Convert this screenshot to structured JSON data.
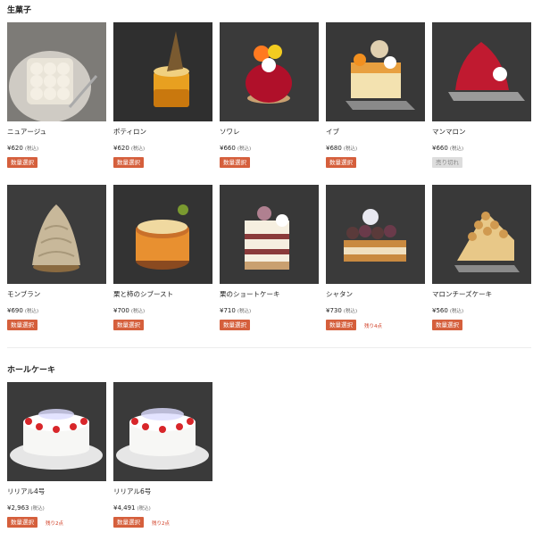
{
  "sections": [
    {
      "title": "生菓子",
      "products": [
        {
          "name": "ニュアージュ",
          "price": "¥620",
          "tax": "(税込)",
          "button": "数量選択",
          "stock": ""
        },
        {
          "name": "ポティロン",
          "price": "¥620",
          "tax": "(税込)",
          "button": "数量選択",
          "stock": ""
        },
        {
          "name": "ソワレ",
          "price": "¥660",
          "tax": "(税込)",
          "button": "数量選択",
          "stock": ""
        },
        {
          "name": "イブ",
          "price": "¥680",
          "tax": "(税込)",
          "button": "数量選択",
          "stock": ""
        },
        {
          "name": "マンマロン",
          "price": "¥660",
          "tax": "(税込)",
          "button": "売り切れ",
          "stock": "",
          "sold_out": true
        },
        {
          "name": "モンブラン",
          "price": "¥690",
          "tax": "(税込)",
          "button": "数量選択",
          "stock": ""
        },
        {
          "name": "栗と柿のシブースト",
          "price": "¥700",
          "tax": "(税込)",
          "button": "数量選択",
          "stock": ""
        },
        {
          "name": "栗のショートケーキ",
          "price": "¥710",
          "tax": "(税込)",
          "button": "数量選択",
          "stock": ""
        },
        {
          "name": "シャタン",
          "price": "¥730",
          "tax": "(税込)",
          "button": "数量選択",
          "stock": "残り4点"
        },
        {
          "name": "マロンチーズケーキ",
          "price": "¥560",
          "tax": "(税込)",
          "button": "数量選択",
          "stock": ""
        }
      ]
    },
    {
      "title": "ホールケーキ",
      "products": [
        {
          "name": "リリアル4号",
          "price": "¥2,963",
          "tax": "(税込)",
          "button": "数量選択",
          "stock": "残り2点"
        },
        {
          "name": "リリアル6号",
          "price": "¥4,491",
          "tax": "(税込)",
          "button": "数量選択",
          "stock": "残り2点"
        }
      ]
    }
  ],
  "colors": {
    "button": "#d55f3c",
    "soldout_button": "#dddddd",
    "stock_text": "#d03a20"
  }
}
